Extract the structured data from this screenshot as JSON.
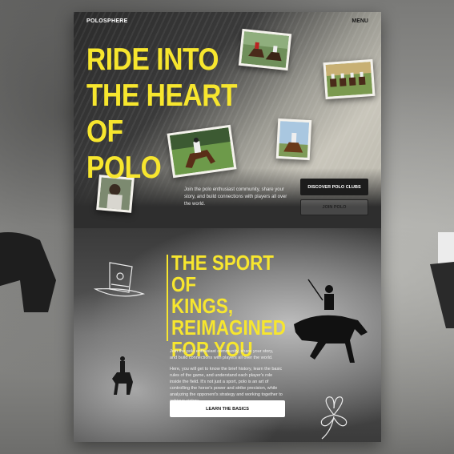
{
  "header": {
    "brand": "POLOSPHERE",
    "menu_label": "MENU"
  },
  "hero": {
    "title": "RIDE INTO\nTHE HEART OF\nPOLO",
    "description": "Join the polo enthusiast community, share your story, and build connections with players all over the world.",
    "discover_button": "DISCOVER POLO CLUBS",
    "join_button": "JOIN POLO"
  },
  "sport_section": {
    "title": "THE SPORT OF\nKINGS,\nREIMAGINED\nFOR YOU",
    "paragraph_1": "Join the polo enthusiast community, share your story, and build connections with players all over the world.",
    "paragraph_2": "Here, you will get to know the brief history, learn the basic rules of the game, and understand each player's role inside the field. It's not just a sport, polo is an art of controlling the horse's power and strike precision, while analyzing the opponent's strategy and working together to achieve victory.",
    "basics_button": "LEARN THE BASICS"
  },
  "colors": {
    "accent_yellow": "#f7e62e",
    "dark": "#1c1c1c",
    "white": "#ffffff"
  },
  "icons": {
    "hat": "top-hat-doodle-icon",
    "clover": "clover-doodle-icon"
  }
}
